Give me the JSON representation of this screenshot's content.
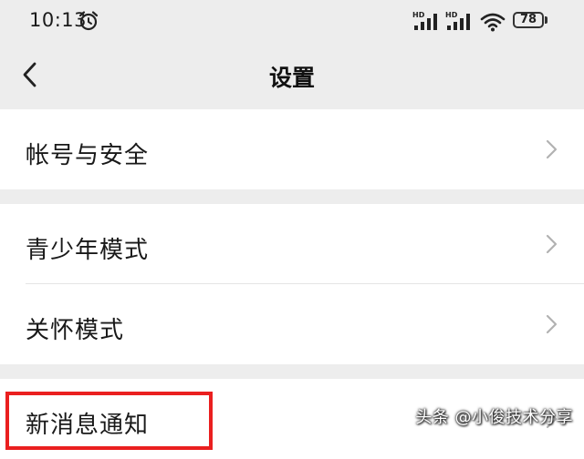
{
  "status_bar": {
    "time": "10:13",
    "signal_1_label": "HD",
    "signal_2_label": "HD",
    "battery": "78",
    "icons": [
      "alarm-icon",
      "signal-icon",
      "signal-icon",
      "wifi-icon",
      "battery-icon"
    ]
  },
  "nav": {
    "title": "设置",
    "back_icon": "chevron-left-icon"
  },
  "groups": [
    {
      "items": [
        {
          "label": "帐号与安全"
        }
      ]
    },
    {
      "items": [
        {
          "label": "青少年模式"
        },
        {
          "label": "关怀模式"
        }
      ]
    },
    {
      "items": [
        {
          "label": "新消息通知"
        }
      ]
    }
  ],
  "highlight": {
    "color": "#ea1f1f"
  },
  "watermark": "头条 @小俊技术分享",
  "colors": {
    "background": "#ededed",
    "row_background": "#ffffff",
    "chevron": "#b2b2b2"
  }
}
